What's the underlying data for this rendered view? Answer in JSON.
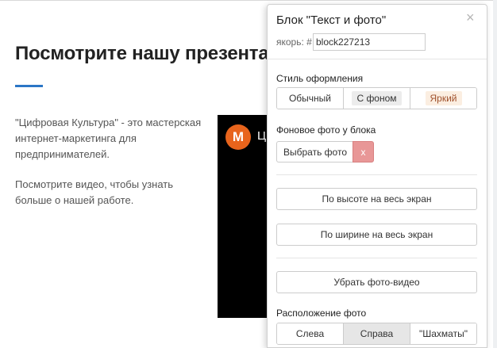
{
  "page": {
    "headline": "Посмотрите нашу презента",
    "accent_color": "#2b76c6",
    "paragraph1": "\"Цифровая Культура\" - это мастерская интернет-маркетинга для предпринимателей.",
    "paragraph2": "Посмотрите видео, чтобы узнать больше о нашей работе.",
    "video": {
      "avatar_letter": "M",
      "title": "Ц"
    }
  },
  "panel": {
    "title": "Блок \"Текст и фото\"",
    "close_icon": "×",
    "anchor_label": "якорь: #",
    "anchor_value": "block227213",
    "style": {
      "label": "Стиль оформления",
      "options": [
        "Обычный",
        "С фоном",
        "Яркий"
      ],
      "bright_color": "#a0522d",
      "bright_bg": "#fbeee1",
      "background_option_bg": "#ececec"
    },
    "background_photo": {
      "label": "Фоновое фото у блока",
      "choose_label": "Выбрать фото",
      "remove_label": "x"
    },
    "buttons": {
      "full_height": "По высоте на весь экран",
      "full_width": "По ширине на весь экран",
      "remove_media": "Убрать фото-видео"
    },
    "photo_position": {
      "label": "Расположение фото",
      "options": [
        "Слева",
        "Справа",
        "\"Шахматы\""
      ],
      "selected": "Справа"
    }
  }
}
